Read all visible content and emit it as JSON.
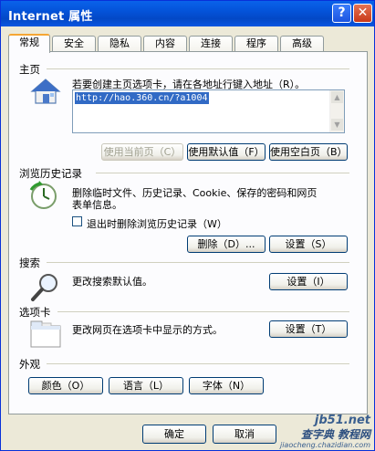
{
  "window": {
    "title": "Internet 属性",
    "help_glyph": "?",
    "close_glyph": "✕"
  },
  "tabs": [
    {
      "label": "常规"
    },
    {
      "label": "安全"
    },
    {
      "label": "隐私"
    },
    {
      "label": "内容"
    },
    {
      "label": "连接"
    },
    {
      "label": "程序"
    },
    {
      "label": "高级"
    }
  ],
  "home": {
    "section": "主页",
    "hint": "若要创建主页选项卡，请在各地址行键入地址（R）。",
    "url": "http://hao.360.cn/?a1004",
    "scroll_up": "▲",
    "scroll_down": "▼",
    "btn_current": "使用当前页（C）",
    "btn_default": "使用默认值（F）",
    "btn_blank": "使用空白页（B）"
  },
  "history": {
    "section": "浏览历史记录",
    "desc1": "删除临时文件、历史记录、Cookie、保存的密码和网页",
    "desc2": "表单信息。",
    "checkbox_label": "退出时删除浏览历史记录（W）",
    "btn_delete": "删除（D）...",
    "btn_settings": "设置（S）"
  },
  "search": {
    "section": "搜索",
    "desc": "更改搜索默认值。",
    "btn_settings": "设置（I）"
  },
  "tabs_section": {
    "section": "选项卡",
    "desc": "更改网页在选项卡中显示的方式。",
    "btn_settings": "设置（T）"
  },
  "appearance": {
    "section": "外观",
    "btn_colors": "颜色（O）",
    "btn_languages": "语言（L）",
    "btn_fonts": "字体（N）"
  },
  "footer": {
    "btn_ok": "确定",
    "btn_cancel": "取消"
  },
  "watermark": {
    "line1": "jb51.net",
    "line2": "查字典 教程网",
    "line3": "jiaocheng.chazidian.com"
  },
  "colors": {
    "title_bar": "#0453d9",
    "tab_accent": "#f5a634",
    "selection": "#316ac5"
  }
}
